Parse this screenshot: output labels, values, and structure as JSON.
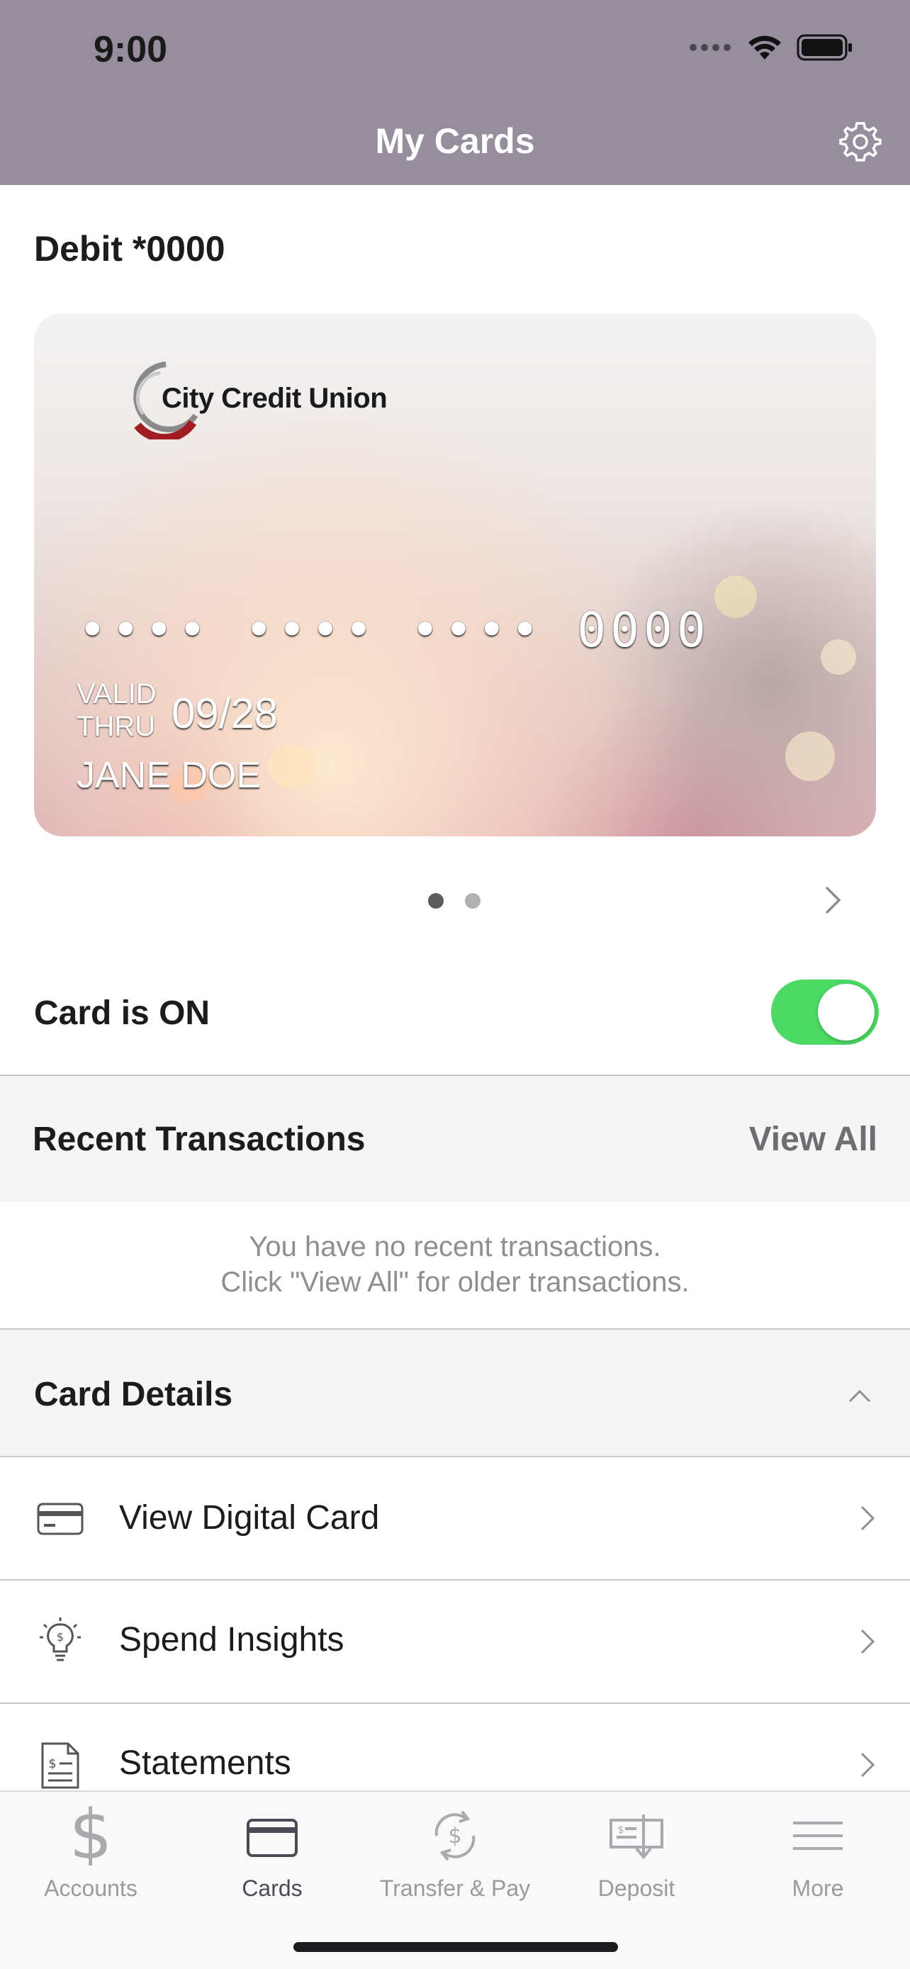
{
  "status_bar": {
    "time": "9:00"
  },
  "header": {
    "title": "My Cards",
    "settings_icon": "gear-icon"
  },
  "card_section": {
    "title": "Debit *0000",
    "card": {
      "issuer": "City Credit Union",
      "number": "•••• •••• •••• 0000",
      "valid_label": "VALID\nTHRU",
      "valid_thru": "09/28",
      "holder": "JANE DOE"
    },
    "pager": {
      "pages": 2,
      "current": 1
    }
  },
  "card_toggle": {
    "label": "Card is ON",
    "on": true,
    "color": "#4cd964"
  },
  "recent_transactions": {
    "title": "Recent Transactions",
    "view_all": "View All",
    "empty_line1": "You have no recent transactions.",
    "empty_line2": "Click \"View All\" for older transactions."
  },
  "card_details": {
    "title": "Card Details",
    "items": [
      {
        "label": "View Digital Card",
        "icon": "card-icon"
      },
      {
        "label": "Spend Insights",
        "icon": "lightbulb-dollar-icon"
      },
      {
        "label": "Statements",
        "icon": "statement-icon"
      }
    ]
  },
  "tabbar": {
    "tabs": [
      {
        "label": "Accounts",
        "icon": "dollar-icon",
        "active": false
      },
      {
        "label": "Cards",
        "icon": "card-icon",
        "active": true
      },
      {
        "label": "Transfer & Pay",
        "icon": "transfer-icon",
        "active": false
      },
      {
        "label": "Deposit",
        "icon": "deposit-check-icon",
        "active": false
      },
      {
        "label": "More",
        "icon": "menu-icon",
        "active": false
      }
    ]
  },
  "colors": {
    "header": "#978e9d",
    "toggle_on": "#4cd964",
    "section_bg": "#f5f5f5"
  }
}
